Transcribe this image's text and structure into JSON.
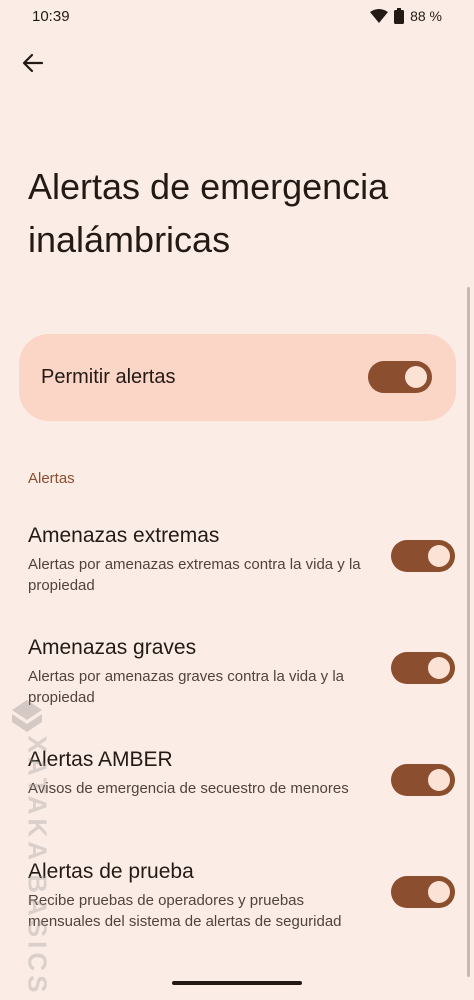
{
  "status_bar": {
    "time": "10:39",
    "battery": "88 %",
    "wifi_icon": "wifi-icon",
    "battery_icon": "battery-icon"
  },
  "header": {
    "back_icon": "arrow-back-icon",
    "title": "Alertas de emergencia inalámbricas"
  },
  "main_switch": {
    "label": "Permitir alertas",
    "checked": true
  },
  "section": {
    "title": "Alertas"
  },
  "items": [
    {
      "title": "Amenazas extremas",
      "summary": "Alertas por amenazas extremas contra la vida y la propiedad",
      "checked": true
    },
    {
      "title": "Amenazas graves",
      "summary": "Alertas por amenazas graves contra la vida y la propiedad",
      "checked": true
    },
    {
      "title": "Alertas AMBER",
      "summary": "Avisos de emergencia de secuestro de menores",
      "checked": true
    },
    {
      "title": "Alertas de prueba",
      "summary": "Recibe pruebas de operadores y pruebas mensuales del sistema de alertas de seguridad",
      "checked": true
    }
  ],
  "watermark": {
    "text": "XATAKA BASICS"
  },
  "colors": {
    "background": "#FBEDE6",
    "card": "#FBD5C6",
    "accent": "#8B4E2E",
    "knob": "#FCE1D5"
  }
}
